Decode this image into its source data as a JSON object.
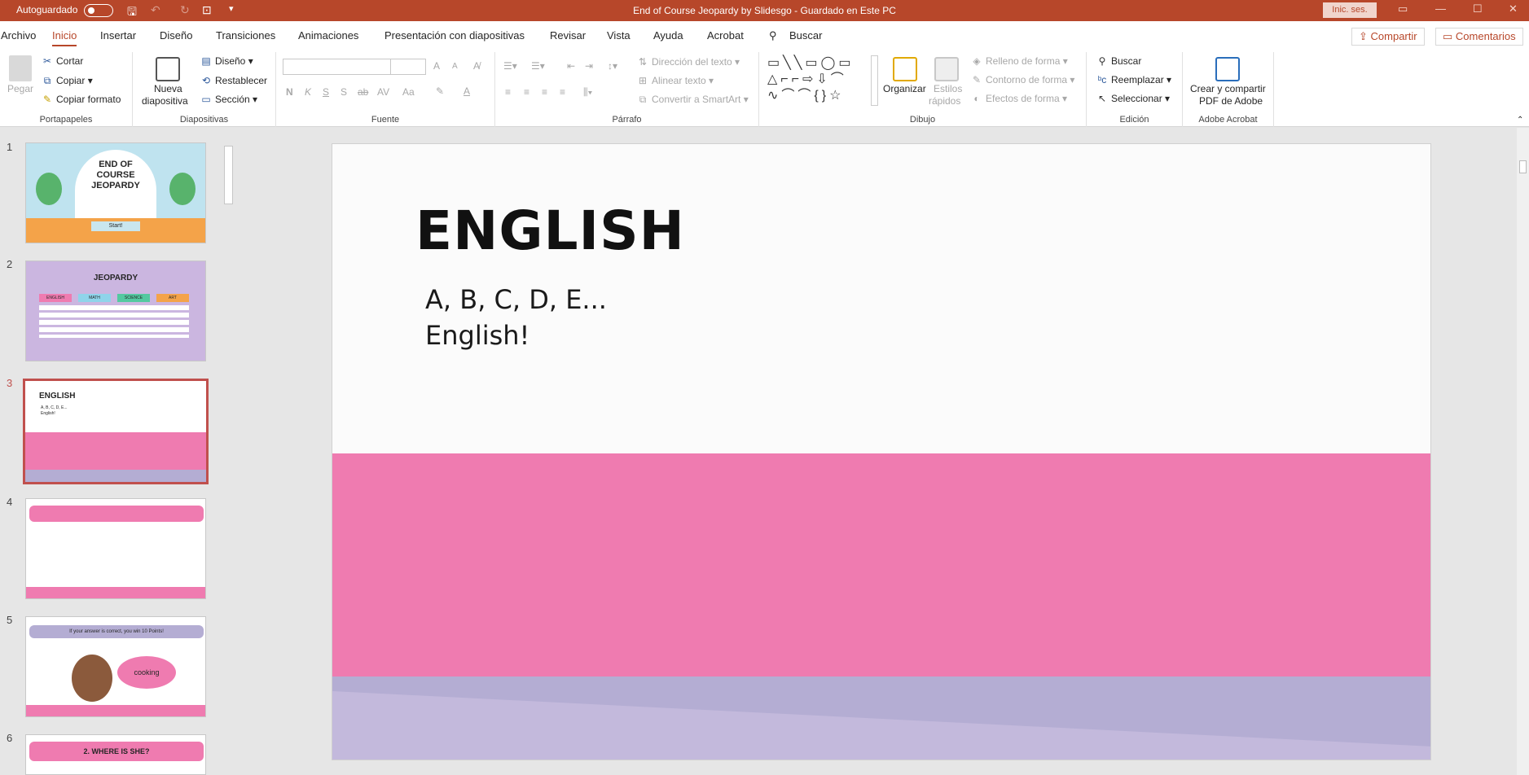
{
  "titlebar": {
    "autosave": "Autoguardado",
    "doc_title": "End of Course Jeopardy by Slidesgo  -  Guardado en Este PC",
    "signin": "Inic. ses."
  },
  "tabs": [
    "Archivo",
    "Inicio",
    "Insertar",
    "Diseño",
    "Transiciones",
    "Animaciones",
    "Presentación con diapositivas",
    "Revisar",
    "Vista",
    "Ayuda",
    "Acrobat"
  ],
  "search": "Buscar",
  "share": "Compartir",
  "comments": "Comentarios",
  "ribbon": {
    "clipboard": {
      "label": "Portapapeles",
      "paste": "Pegar",
      "cut": "Cortar",
      "copy": "Copiar",
      "format_painter": "Copiar formato"
    },
    "slides": {
      "label": "Diapositivas",
      "new_slide_1": "Nueva",
      "new_slide_2": "diapositiva",
      "layout": "Diseño",
      "reset": "Restablecer",
      "section": "Sección"
    },
    "font": {
      "label": "Fuente",
      "bold": "N",
      "italic": "K",
      "underline": "S",
      "shadow": "S",
      "strike": "ab",
      "spacing": "AV",
      "case": "Aa",
      "size_up": "A",
      "size_down": "A"
    },
    "paragraph": {
      "label": "Párrafo",
      "text_direction": "Dirección del texto",
      "align_text": "Alinear texto",
      "smartart": "Convertir a SmartArt"
    },
    "drawing": {
      "label": "Dibujo",
      "arrange": "Organizar",
      "quick_styles_1": "Estilos",
      "quick_styles_2": "rápidos",
      "shape_fill": "Relleno de forma",
      "shape_outline": "Contorno de forma",
      "shape_effects": "Efectos de forma"
    },
    "editing": {
      "label": "Edición",
      "find": "Buscar",
      "replace": "Reemplazar",
      "select": "Seleccionar"
    },
    "acrobat": {
      "label": "Adobe Acrobat",
      "create_1": "Crear y compartir",
      "create_2": "PDF de Adobe"
    }
  },
  "thumbnails": [
    {
      "num": "1",
      "title": "END OF COURSE JEOPARDY",
      "button": "Start!"
    },
    {
      "num": "2",
      "title": "JEOPARDY",
      "cats": [
        "ENGLISH",
        "MATH",
        "SCIENCE",
        "ART"
      ]
    },
    {
      "num": "3",
      "title": "ENGLISH",
      "body1": "A, B, C, D, E...",
      "body2": "English!"
    },
    {
      "num": "4"
    },
    {
      "num": "5",
      "banner": "If your answer is correct, you win 10 Points!",
      "bubble": "cooking"
    },
    {
      "num": "6",
      "banner": "2. WHERE IS SHE?"
    }
  ],
  "slide": {
    "title": "ENGLISH",
    "body_line1": "A, B, C, D, E...",
    "body_line2": "English!"
  },
  "colors": {
    "accent": "#b7472a",
    "pink": "#ef7bb0",
    "lavender": "#b4add3"
  }
}
